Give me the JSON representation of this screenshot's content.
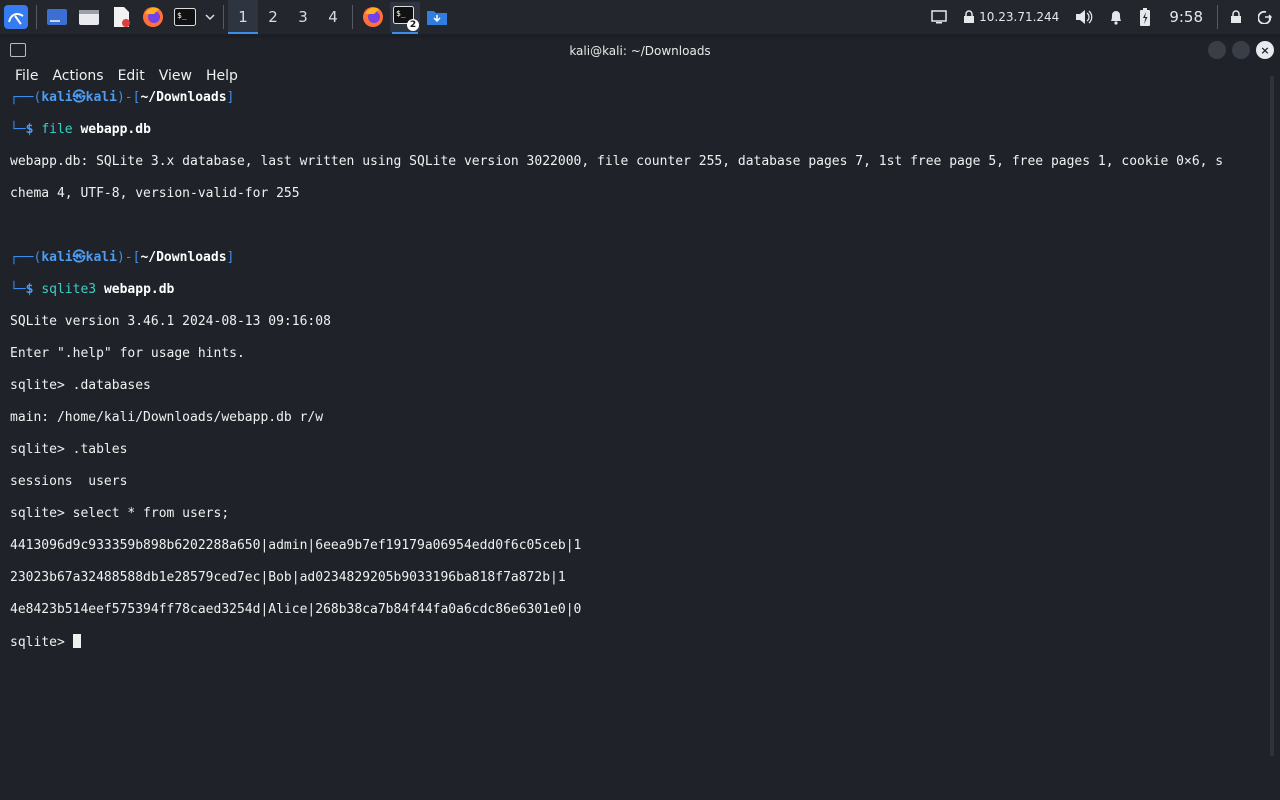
{
  "taskbar": {
    "workspaces": [
      "1",
      "2",
      "3",
      "4"
    ],
    "active_workspace": 0,
    "terminal_badge": "2",
    "ip": "10.23.71.244",
    "clock": "9:58",
    "icons": [
      "kali-menu-icon",
      "desktop-icon",
      "file-manager-icon",
      "text-editor-icon",
      "firefox-icon",
      "terminal-icon",
      "chevron-down-icon",
      "firefox-icon",
      "terminal-icon",
      "folder-download-icon",
      "display-icon",
      "lock-icon",
      "volume-icon",
      "bell-icon",
      "battery-icon",
      "screen-lock-icon",
      "logout-icon"
    ]
  },
  "window": {
    "title": "kali@kali: ~/Downloads",
    "menu": [
      "File",
      "Actions",
      "Edit",
      "View",
      "Help"
    ]
  },
  "terminal": {
    "prompt": {
      "user": "kali",
      "host": "kali",
      "dir": "~/Downloads"
    },
    "cmd1": "file",
    "cmd1_arg": "webapp.db",
    "out1_a": "webapp.db: SQLite 3.x database, last written using SQLite version 3022000, file counter 255, database pages 7, 1st free page 5, free pages 1, cookie 0×6, s",
    "out1_b": "chema 4, UTF-8, version-valid-for 255",
    "cmd2": "sqlite3",
    "cmd2_arg": "webapp.db",
    "lines": [
      "SQLite version 3.46.1 2024-08-13 09:16:08",
      "Enter \".help\" for usage hints.",
      "sqlite> .databases",
      "main: /home/kali/Downloads/webapp.db r/w",
      "sqlite> .tables",
      "sessions  users",
      "sqlite> select * from users;",
      "4413096d9c933359b898b6202288a650|admin|6eea9b7ef19179a06954edd0f6c05ceb|1",
      "23023b67a32488588db1e28579ced7ec|Bob|ad0234829205b9033196ba818f7a872b|1",
      "4e8423b514eef575394ff78caed3254d|Alice|268b38ca7b84f44fa0a6cdc86e6301e0|0"
    ],
    "final_prompt": "sqlite> "
  }
}
